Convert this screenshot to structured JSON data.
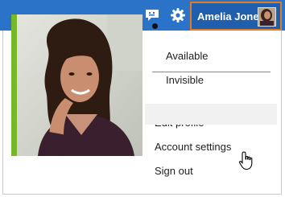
{
  "topbar": {
    "chat_icon": "chat-bubble-icon",
    "settings_icon": "gear-icon",
    "user_name": "Amelia Jones",
    "accent_color": "#2a73c8",
    "highlight_color": "#e07c21"
  },
  "menu": {
    "accent_color": "#76b82a",
    "status_options": [
      {
        "label": "Available",
        "selected": true
      },
      {
        "label": "Invisible",
        "selected": false
      }
    ],
    "actions": [
      {
        "label": "Edit profile"
      },
      {
        "label": "Account settings",
        "hovered": true
      },
      {
        "label": "Sign out"
      }
    ]
  }
}
